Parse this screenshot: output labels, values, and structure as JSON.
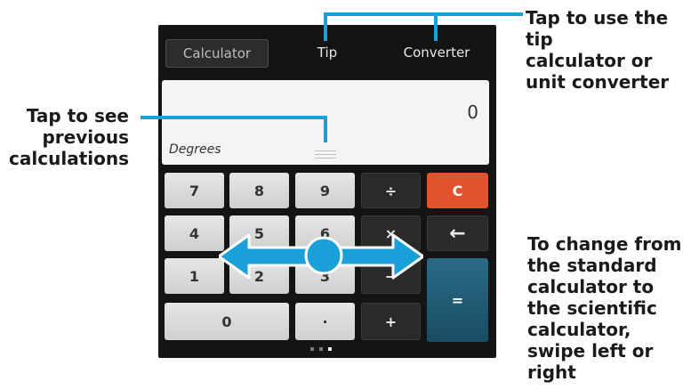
{
  "callouts": {
    "tip_converter": [
      "Tap to use the tip",
      "calculator or",
      "unit converter"
    ],
    "history": [
      "Tap to see",
      "previous",
      "calculations"
    ],
    "swipe": [
      "To change from",
      "the standard",
      "calculator to",
      "the scientific",
      "calculator,",
      "swipe left or",
      "right"
    ]
  },
  "tabs": [
    {
      "label": "Calculator"
    },
    {
      "label": "Tip"
    },
    {
      "label": "Converter"
    }
  ],
  "display": {
    "value": "0",
    "mode": "Degrees"
  },
  "keys": {
    "k7": "7",
    "k8": "8",
    "k9": "9",
    "divide": "÷",
    "clear": "C",
    "k4": "4",
    "k5": "5",
    "k6": "6",
    "multiply": "×",
    "backspace": "←",
    "k1": "1",
    "k2": "2",
    "k3": "3",
    "minus": "−",
    "equals": "=",
    "k0": "0",
    "decimal": "·",
    "plus": "+"
  },
  "colors": {
    "accent": "#1aa0d8",
    "clear": "#e0532e",
    "equals": "#184c63"
  },
  "page_indicator": {
    "pages": 3,
    "active": 3
  }
}
